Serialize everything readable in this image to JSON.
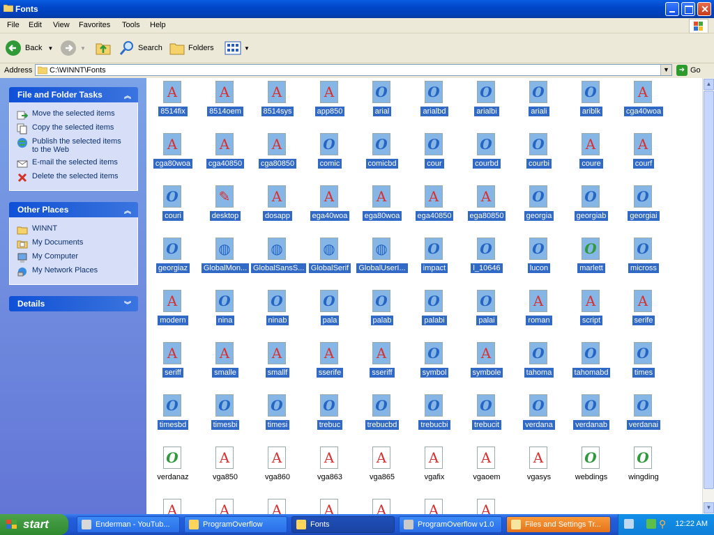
{
  "window": {
    "title": "Fonts"
  },
  "menu": [
    "File",
    "Edit",
    "View",
    "Favorites",
    "Tools",
    "Help"
  ],
  "toolbar": {
    "back": "Back",
    "search": "Search",
    "folders": "Folders"
  },
  "address": {
    "label": "Address",
    "path": "C:\\WINNT\\Fonts",
    "go": "Go"
  },
  "file_tasks": {
    "title": "File and Folder Tasks",
    "items": [
      {
        "label": "Move the selected items",
        "icon": "move-icon"
      },
      {
        "label": "Copy the selected items",
        "icon": "copy-icon"
      },
      {
        "label": "Publish the selected items to the Web",
        "icon": "publish-web-icon"
      },
      {
        "label": "E-mail the selected items",
        "icon": "email-icon"
      },
      {
        "label": "Delete the selected items",
        "icon": "delete-icon"
      }
    ]
  },
  "other_places": {
    "title": "Other Places",
    "items": [
      {
        "label": "WINNT",
        "icon": "folder-icon"
      },
      {
        "label": "My Documents",
        "icon": "my-documents-icon"
      },
      {
        "label": "My Computer",
        "icon": "my-computer-icon"
      },
      {
        "label": "My Network Places",
        "icon": "network-places-icon"
      }
    ]
  },
  "details": {
    "title": "Details"
  },
  "files": [
    {
      "name": "8514fix",
      "type": "A",
      "selected": true
    },
    {
      "name": "8514oem",
      "type": "A",
      "selected": true
    },
    {
      "name": "8514sys",
      "type": "A",
      "selected": true
    },
    {
      "name": "app850",
      "type": "A",
      "selected": true
    },
    {
      "name": "arial",
      "type": "O",
      "selected": true
    },
    {
      "name": "arialbd",
      "type": "O",
      "selected": true
    },
    {
      "name": "arialbi",
      "type": "O",
      "selected": true
    },
    {
      "name": "ariali",
      "type": "O",
      "selected": true
    },
    {
      "name": "ariblk",
      "type": "O",
      "selected": true
    },
    {
      "name": "cga40woa",
      "type": "A",
      "selected": true
    },
    {
      "name": "cga80woa",
      "type": "A",
      "selected": true
    },
    {
      "name": "cga40850",
      "type": "A",
      "selected": true
    },
    {
      "name": "cga80850",
      "type": "A",
      "selected": true
    },
    {
      "name": "comic",
      "type": "O",
      "selected": true
    },
    {
      "name": "comicbd",
      "type": "O",
      "selected": true
    },
    {
      "name": "cour",
      "type": "O",
      "selected": true
    },
    {
      "name": "courbd",
      "type": "O",
      "selected": true
    },
    {
      "name": "courbi",
      "type": "O",
      "selected": true
    },
    {
      "name": "coure",
      "type": "A",
      "selected": true
    },
    {
      "name": "courf",
      "type": "A",
      "selected": true
    },
    {
      "name": "couri",
      "type": "O",
      "selected": true
    },
    {
      "name": "desktop",
      "type": "INI",
      "selected": true
    },
    {
      "name": "dosapp",
      "type": "A",
      "selected": true
    },
    {
      "name": "ega40woa",
      "type": "A",
      "selected": true
    },
    {
      "name": "ega80woa",
      "type": "A",
      "selected": true
    },
    {
      "name": "ega40850",
      "type": "A",
      "selected": true
    },
    {
      "name": "ega80850",
      "type": "A",
      "selected": true
    },
    {
      "name": "georgia",
      "type": "O",
      "selected": true
    },
    {
      "name": "georgiab",
      "type": "O",
      "selected": true
    },
    {
      "name": "georgiai",
      "type": "O",
      "selected": true
    },
    {
      "name": "georgiaz",
      "type": "O",
      "selected": true
    },
    {
      "name": "GlobalMon...",
      "type": "SAMPLE",
      "selected": true
    },
    {
      "name": "GlobalSansS...",
      "type": "SAMPLE",
      "selected": true
    },
    {
      "name": "GlobalSerif",
      "type": "SAMPLE",
      "selected": true
    },
    {
      "name": "GlobalUserI...",
      "type": "SAMPLE",
      "selected": true
    },
    {
      "name": "impact",
      "type": "O",
      "selected": true
    },
    {
      "name": "l_10646",
      "type": "O",
      "selected": true
    },
    {
      "name": "lucon",
      "type": "O",
      "selected": true
    },
    {
      "name": "marlett",
      "type": "G",
      "selected": true
    },
    {
      "name": "micross",
      "type": "O",
      "selected": true
    },
    {
      "name": "modern",
      "type": "A",
      "selected": true
    },
    {
      "name": "nina",
      "type": "O",
      "selected": true
    },
    {
      "name": "ninab",
      "type": "O",
      "selected": true
    },
    {
      "name": "pala",
      "type": "O",
      "selected": true
    },
    {
      "name": "palab",
      "type": "O",
      "selected": true
    },
    {
      "name": "palabi",
      "type": "O",
      "selected": true
    },
    {
      "name": "palai",
      "type": "O",
      "selected": true
    },
    {
      "name": "roman",
      "type": "A",
      "selected": true
    },
    {
      "name": "script",
      "type": "A",
      "selected": true
    },
    {
      "name": "serife",
      "type": "A",
      "selected": true
    },
    {
      "name": "seriff",
      "type": "A",
      "selected": true
    },
    {
      "name": "smalle",
      "type": "A",
      "selected": true
    },
    {
      "name": "smallf",
      "type": "A",
      "selected": true
    },
    {
      "name": "sserife",
      "type": "A",
      "selected": true
    },
    {
      "name": "sseriff",
      "type": "A",
      "selected": true
    },
    {
      "name": "symbol",
      "type": "O",
      "selected": true
    },
    {
      "name": "symbole",
      "type": "A",
      "selected": true
    },
    {
      "name": "tahoma",
      "type": "O",
      "selected": true
    },
    {
      "name": "tahomabd",
      "type": "O",
      "selected": true
    },
    {
      "name": "times",
      "type": "O",
      "selected": true
    },
    {
      "name": "timesbd",
      "type": "O",
      "selected": true
    },
    {
      "name": "timesbi",
      "type": "O",
      "selected": true
    },
    {
      "name": "timesi",
      "type": "O",
      "selected": true
    },
    {
      "name": "trebuc",
      "type": "O",
      "selected": true
    },
    {
      "name": "trebucbd",
      "type": "O",
      "selected": true
    },
    {
      "name": "trebucbi",
      "type": "O",
      "selected": true
    },
    {
      "name": "trebucit",
      "type": "O",
      "selected": true
    },
    {
      "name": "verdana",
      "type": "O",
      "selected": true
    },
    {
      "name": "verdanab",
      "type": "O",
      "selected": true
    },
    {
      "name": "verdanai",
      "type": "O",
      "selected": true
    },
    {
      "name": "verdanaz",
      "type": "G",
      "selected": false
    },
    {
      "name": "vga850",
      "type": "A",
      "selected": false
    },
    {
      "name": "vga860",
      "type": "A",
      "selected": false
    },
    {
      "name": "vga863",
      "type": "A",
      "selected": false
    },
    {
      "name": "vga865",
      "type": "A",
      "selected": false
    },
    {
      "name": "vgafix",
      "type": "A",
      "selected": false
    },
    {
      "name": "vgaoem",
      "type": "A",
      "selected": false
    },
    {
      "name": "vgasys",
      "type": "A",
      "selected": false
    },
    {
      "name": "webdings",
      "type": "G",
      "selected": false
    },
    {
      "name": "wingding",
      "type": "G",
      "selected": false
    },
    {
      "name": "",
      "type": "A",
      "selected": false
    },
    {
      "name": "",
      "type": "A",
      "selected": false
    },
    {
      "name": "",
      "type": "A",
      "selected": false
    },
    {
      "name": "",
      "type": "A",
      "selected": false
    },
    {
      "name": "",
      "type": "A",
      "selected": false
    },
    {
      "name": "",
      "type": "A",
      "selected": false
    },
    {
      "name": "",
      "type": "A",
      "selected": false
    }
  ],
  "taskbar": {
    "start": "start",
    "items": [
      {
        "label": "Enderman - YouTub...",
        "state": "normal"
      },
      {
        "label": "ProgramOverflow",
        "state": "normal"
      },
      {
        "label": "Fonts",
        "state": "active"
      },
      {
        "label": "ProgramOverflow v1.0",
        "state": "normal"
      },
      {
        "label": "Files and Settings Tr...",
        "state": "flash"
      }
    ],
    "clock": "12:22 AM"
  },
  "colors": {
    "titlebar": "#0046c8",
    "selection": "#3169c6",
    "taskpane": "#6375d6",
    "start": "#2f8a2f"
  }
}
